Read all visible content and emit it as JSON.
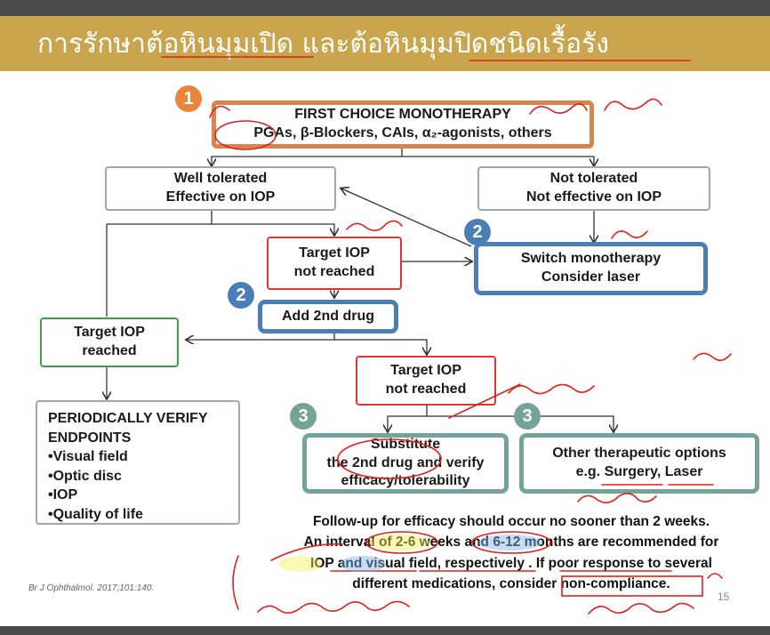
{
  "title": "การรักษาต้อหินมุมเปิด และต้อหินมุมปิดชนิดเรื้อรัง",
  "nodes": {
    "first_choice": {
      "line1": "FIRST CHOICE MONOTHERAPY",
      "line2": "PGAs, β-Blockers, CAIs, α₂-agonists, others"
    },
    "well_tolerated": {
      "line1": "Well tolerated",
      "line2": "Effective on IOP"
    },
    "not_tolerated": {
      "line1": "Not tolerated",
      "line2": "Not effective on IOP"
    },
    "target_not_reached_1": {
      "line1": "Target IOP",
      "line2": "not reached"
    },
    "switch": {
      "line1": "Switch monotherapy",
      "line2": "Consider laser"
    },
    "add_drug": {
      "label": "Add 2nd drug"
    },
    "target_reached": {
      "line1": "Target IOP",
      "line2": "reached"
    },
    "target_not_reached_2": {
      "line1": "Target IOP",
      "line2": "not reached"
    },
    "verify": {
      "title1": "PERIODICALLY VERIFY",
      "title2": "ENDPOINTS",
      "items": [
        "•Visual field",
        "•Optic disc",
        "•IOP",
        "•Quality of life"
      ]
    },
    "substitute": {
      "line1": "Substitute",
      "line2": "the 2nd drug and verify",
      "line3": "efficacy/tolerability"
    },
    "other_options": {
      "line1": "Other therapeutic options",
      "line2": "e.g. Surgery, Laser"
    }
  },
  "badges": {
    "b1": "1",
    "b2a": "2",
    "b2b": "2",
    "b3a": "3",
    "b3b": "3"
  },
  "notes": {
    "line1": "Follow-up for efficacy should occur no sooner than 2 weeks.",
    "line2": "An interval of 2-6 weeks and 6-12 months are recommended for",
    "line3": "IOP and visual field, respectively . If poor response to several",
    "line4": "different medications, consider non-compliance."
  },
  "citation": "Br J Ophthalmol. 2017;101:140.",
  "page_number": "15",
  "colors": {
    "title_band": "#c9a64d",
    "orange": "#d8844e",
    "blue": "#4a7fb5",
    "teal": "#76a398",
    "green": "#3aa046",
    "red": "#d93a35",
    "gray": "#9aa9b4",
    "ink": "#e0201a",
    "highlight_yellow": "#f4f05a",
    "highlight_blue": "#7fb5e8"
  }
}
